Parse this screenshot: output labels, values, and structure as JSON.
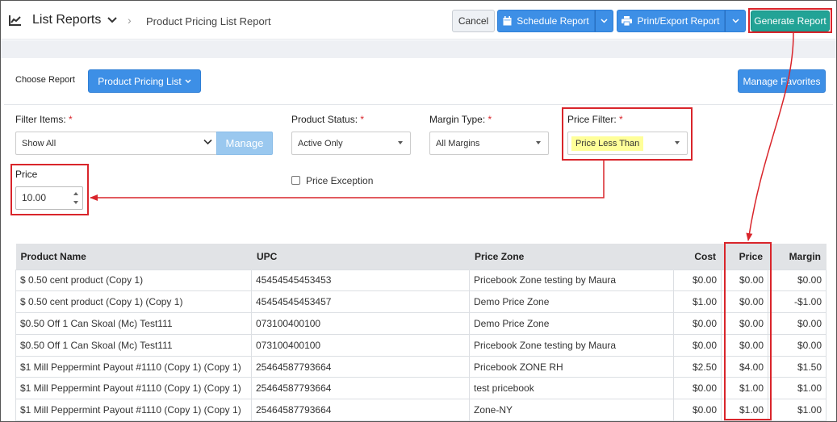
{
  "header": {
    "app_title": "List Reports",
    "breadcrumb": "Product Pricing List Report",
    "cancel_label": "Cancel",
    "schedule_label": "Schedule Report",
    "print_label": "Print/Export Report",
    "generate_label": "Generate Report"
  },
  "report_bar": {
    "choose_label": "Choose Report",
    "report_select_label": "Product Pricing List",
    "favorites_label": "Manage Favorites"
  },
  "filters": {
    "filter_items": {
      "label": "Filter Items:",
      "required": "*",
      "value": "Show All",
      "manage_label": "Manage"
    },
    "product_status": {
      "label": "Product Status:",
      "required": "*",
      "value": "Active Only"
    },
    "margin_type": {
      "label": "Margin Type:",
      "required": "*",
      "value": "All Margins"
    },
    "price_filter": {
      "label": "Price Filter:",
      "required": "*",
      "value": "Price Less Than"
    },
    "price": {
      "label": "Price",
      "value": "10.00"
    },
    "price_exception": {
      "label": "Price Exception",
      "checked": false
    }
  },
  "table": {
    "columns": [
      "Product Name",
      "UPC",
      "Price Zone",
      "Cost",
      "Price",
      "Margin"
    ],
    "rows": [
      [
        "$ 0.50 cent product (Copy 1)",
        "45454545453453",
        "Pricebook Zone testing by Maura",
        "$0.00",
        "$0.00",
        "$0.00"
      ],
      [
        "$ 0.50 cent product (Copy 1) (Copy 1)",
        "45454545453457",
        "Demo Price Zone",
        "$1.00",
        "$0.00",
        "-$1.00"
      ],
      [
        "$0.50 Off 1 Can Skoal (Mc) Test111",
        "073100400100",
        "Demo Price Zone",
        "$0.00",
        "$0.00",
        "$0.00"
      ],
      [
        "$0.50 Off 1 Can Skoal (Mc) Test111",
        "073100400100",
        "Pricebook Zone testing by Maura",
        "$0.00",
        "$0.00",
        "$0.00"
      ],
      [
        "$1 Mill Peppermint Payout #1110 (Copy 1) (Copy 1)",
        "25464587793664",
        "Pricebook ZONE RH",
        "$2.50",
        "$4.00",
        "$1.50"
      ],
      [
        "$1 Mill Peppermint Payout #1110 (Copy 1) (Copy 1)",
        "25464587793664",
        "test pricebook",
        "$0.00",
        "$1.00",
        "$1.00"
      ],
      [
        "$1 Mill Peppermint Payout #1110 (Copy 1) (Copy 1)",
        "25464587793664",
        "Zone-NY",
        "$0.00",
        "$1.00",
        "$1.00"
      ]
    ]
  },
  "colors": {
    "primary_blue": "#3d8fe6",
    "generate_green": "#22a396",
    "annotation_red": "#d9252b",
    "highlight_yellow": "#ffff99"
  }
}
